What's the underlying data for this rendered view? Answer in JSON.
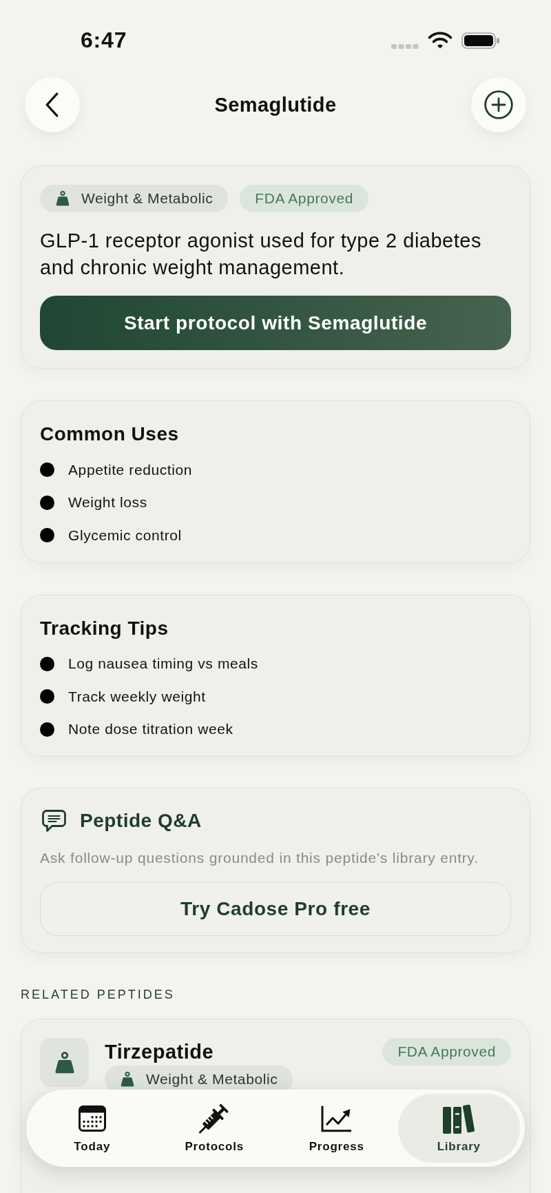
{
  "status_bar": {
    "time": "6:47"
  },
  "header": {
    "title": "Semaglutide"
  },
  "overview": {
    "tags": [
      {
        "kind": "category",
        "label": "Weight & Metabolic"
      },
      {
        "kind": "status",
        "label": "FDA Approved"
      }
    ],
    "description": "GLP-1 receptor agonist used for type 2 diabetes and chronic weight management.",
    "action": "Start protocol with Semaglutide"
  },
  "sections": [
    {
      "title": "Common Uses",
      "items": [
        "Appetite reduction",
        "Weight loss",
        "Glycemic control"
      ]
    },
    {
      "title": "Tracking Tips",
      "items": [
        "Log nausea timing vs meals",
        "Track weekly weight",
        "Note dose titration week"
      ]
    }
  ],
  "qa": {
    "title": "Peptide Q&A",
    "subtitle": "Ask follow-up questions grounded in this peptide's library entry.",
    "button": "Try Cadose Pro free"
  },
  "related": {
    "heading": "RELATED PEPTIDES",
    "items": [
      {
        "name": "Tirzepatide",
        "status": "FDA Approved",
        "category": "Weight & Metabolic"
      }
    ]
  },
  "tab_bar": [
    {
      "label": "Today",
      "selected": false
    },
    {
      "label": "Protocols",
      "selected": false
    },
    {
      "label": "Progress",
      "selected": false
    },
    {
      "label": "Library",
      "selected": true
    }
  ]
}
